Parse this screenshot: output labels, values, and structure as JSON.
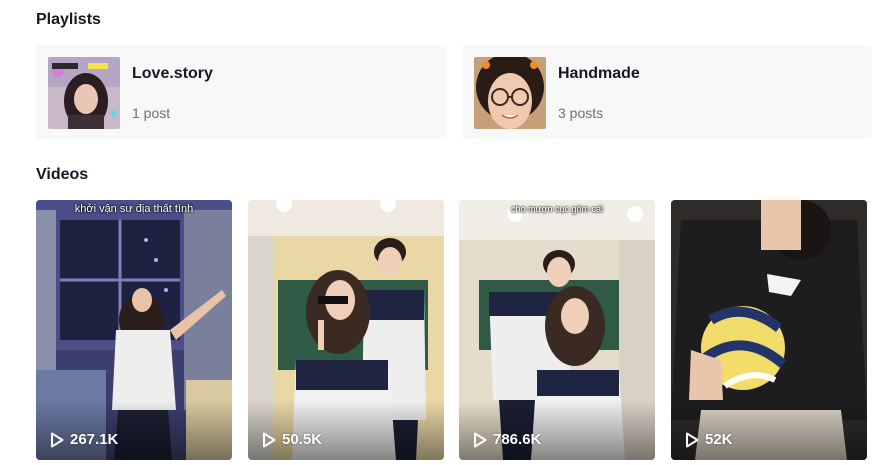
{
  "playlists": {
    "title": "Playlists",
    "items": [
      {
        "name": "Love.story",
        "count": "1 post"
      },
      {
        "name": "Handmade",
        "count": "3 posts"
      }
    ]
  },
  "videos": {
    "title": "Videos",
    "items": [
      {
        "views": "267.1K",
        "caption": "khởi vận sư địa thất tình"
      },
      {
        "views": "50.5K",
        "caption": ""
      },
      {
        "views": "786.6K",
        "caption": "cho mượn cục gôm cái"
      },
      {
        "views": "52K",
        "caption": ""
      }
    ]
  },
  "icons": {
    "play": "play-icon"
  },
  "colors": {
    "card_bg": "#f8f8f8",
    "text": "#161823",
    "muted": "#6f7075"
  }
}
